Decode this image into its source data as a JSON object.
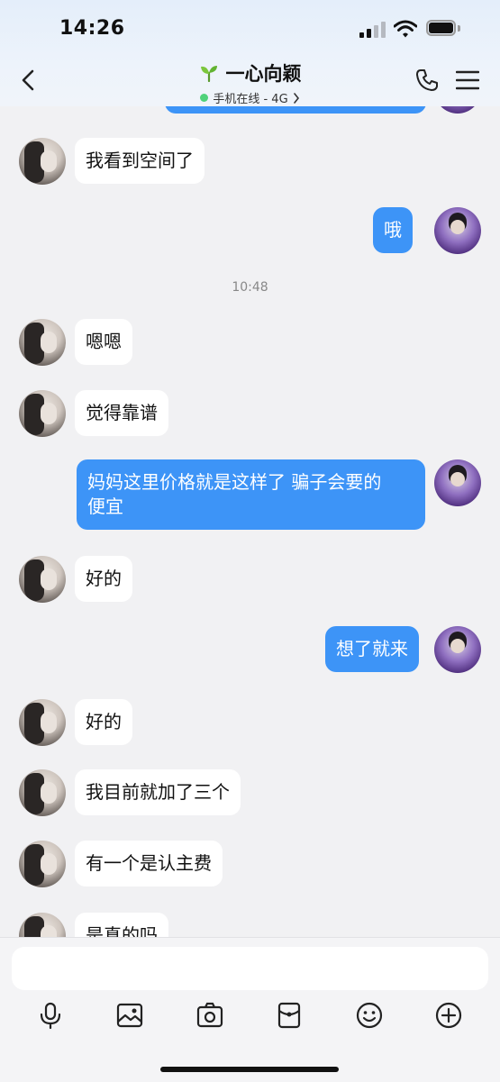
{
  "status_bar": {
    "time": "14:26"
  },
  "header": {
    "contact_name": "一心向颖",
    "status_text": "手机在线 - 4G",
    "icons": [
      "back-icon",
      "sprout-icon",
      "phone-icon",
      "menu-icon"
    ]
  },
  "colors": {
    "outgoing_bubble": "#3d94f7",
    "incoming_bubble": "#ffffff",
    "online_dot": "#4fd27a"
  },
  "messages": [
    {
      "dir": "in",
      "text": "我看到空间了"
    },
    {
      "dir": "out",
      "text": "哦"
    },
    {
      "type": "timestamp",
      "text": "10:48"
    },
    {
      "dir": "in",
      "text": "嗯嗯"
    },
    {
      "dir": "in",
      "text": "觉得靠谱"
    },
    {
      "dir": "out",
      "text": "妈妈这里价格就是这样了 骗子会要的\n便宜"
    },
    {
      "dir": "in",
      "text": "好的"
    },
    {
      "dir": "out",
      "text": "想了就来"
    },
    {
      "dir": "in",
      "text": "好的"
    },
    {
      "dir": "in",
      "text": "我目前就加了三个"
    },
    {
      "dir": "in",
      "text": "有一个是认主费"
    },
    {
      "dir": "in",
      "text": "是真的吗"
    }
  ],
  "toolbar": {
    "input_placeholder": "",
    "tools": [
      "microphone-icon",
      "image-icon",
      "camera-icon",
      "red-packet-icon",
      "emoji-icon",
      "plus-icon"
    ]
  }
}
